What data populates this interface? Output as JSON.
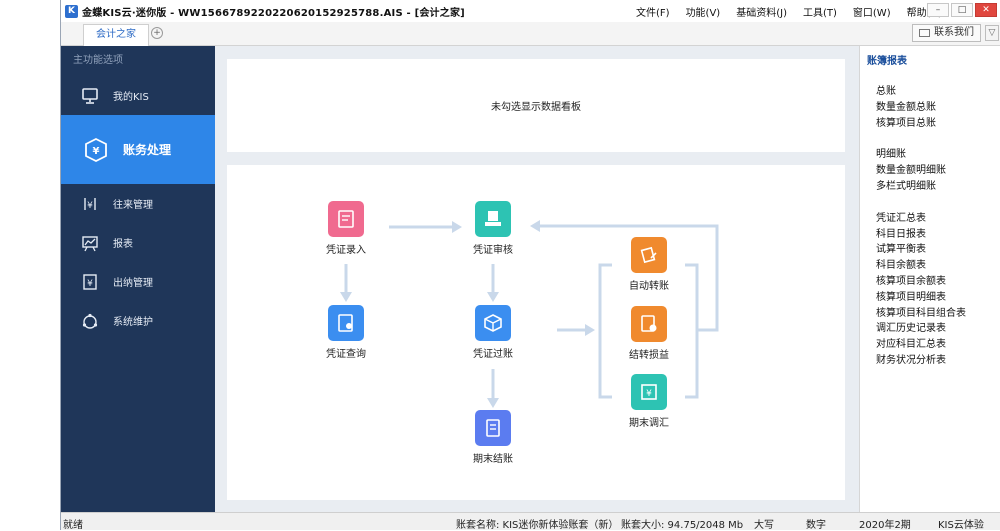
{
  "window": {
    "title": "金蝶KIS云·迷你版 - WW1566789220220620152925788.AIS - [会计之家]",
    "menu": [
      "文件(F)",
      "功能(V)",
      "基础资料(J)",
      "工具(T)",
      "窗口(W)",
      "帮助(H)"
    ],
    "controls": {
      "minimize": "–",
      "maximize": "□",
      "close": "✕"
    }
  },
  "tabs": {
    "active_tab": "会计之家",
    "add_symbol": "+",
    "contact_label": "联系我们",
    "collapse_symbol": "▽"
  },
  "sidebar": {
    "heading": "主功能选项",
    "items": [
      {
        "label": "我的KIS",
        "icon": "monitor-icon"
      },
      {
        "label": "账务处理",
        "icon": "yen-shield-icon",
        "active": true
      },
      {
        "label": "往来管理",
        "icon": "yen-exchange-icon"
      },
      {
        "label": "报表",
        "icon": "chart-board-icon"
      },
      {
        "label": "出纳管理",
        "icon": "yen-book-icon"
      },
      {
        "label": "系统维护",
        "icon": "cycle-icon"
      }
    ]
  },
  "main": {
    "board_message": "未勾选显示数据看板",
    "flow_nodes": {
      "voucher_entry": {
        "label": "凭证录入",
        "color": "#f06a8f",
        "icon": "voucher-entry-icon"
      },
      "voucher_review": {
        "label": "凭证审核",
        "color": "#2dc3b3",
        "icon": "voucher-review-icon"
      },
      "voucher_query": {
        "label": "凭证查询",
        "color": "#3b8ef0",
        "icon": "voucher-query-icon"
      },
      "voucher_post": {
        "label": "凭证过账",
        "color": "#3b8ef0",
        "icon": "voucher-post-icon"
      },
      "period_close": {
        "label": "期末结账",
        "color": "#5b7cf0",
        "icon": "period-close-icon"
      },
      "auto_transfer": {
        "label": "自动转账",
        "color": "#f08a2e",
        "icon": "auto-transfer-icon"
      },
      "carry_profit": {
        "label": "结转损益",
        "color": "#f08a2e",
        "icon": "carry-profit-icon"
      },
      "period_adjust": {
        "label": "期末调汇",
        "color": "#2dc3b3",
        "icon": "period-adjust-icon"
      }
    }
  },
  "rightpane": {
    "title": "账簿报表",
    "groups": [
      [
        "总账",
        "数量金额总账",
        "核算项目总账"
      ],
      [
        "明细账",
        "数量金额明细账",
        "多栏式明细账"
      ],
      [
        "凭证汇总表",
        "科目日报表",
        "试算平衡表",
        "科目余额表",
        "核算项目余额表",
        "核算项目明细表",
        "核算项目科目组合表",
        "调汇历史记录表",
        "对应科目汇总表",
        "财务状况分析表"
      ]
    ]
  },
  "statusbar": {
    "ready": "就绪",
    "account_name": "账套名称: KIS迷你新体验账套（新）",
    "account_size": "账套大小: 94.75/2048 Mb",
    "caps": "大写",
    "numlock": "数字",
    "period": "2020年2期",
    "edition": "KIS云体验"
  },
  "colors": {
    "sidebar_bg": "#1f3659",
    "sidebar_active": "#2e86e8",
    "arrow": "#c9d8ea",
    "accent": "#1b4f9c"
  }
}
